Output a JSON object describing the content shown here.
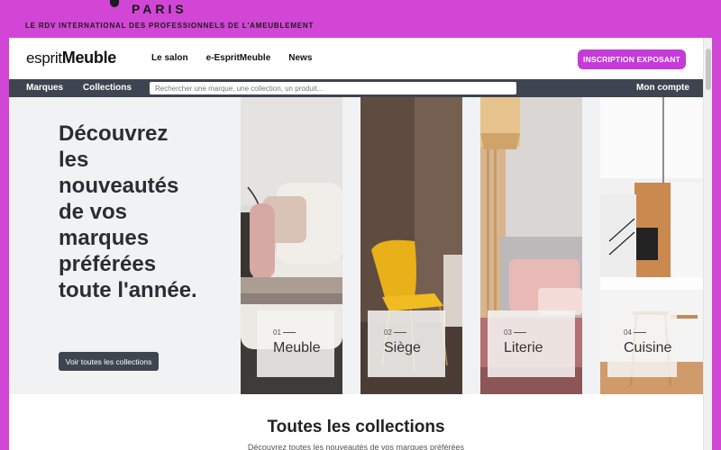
{
  "banner": {
    "city": "PARIS",
    "tagline": "LE RDV INTERNATIONAL DES PROFESSIONNELS DE L'AMEUBLEMENT"
  },
  "header": {
    "logo_prefix": "esprit",
    "logo_suffix": "Meuble",
    "nav": [
      "Le salon",
      "e-EspritMeuble",
      "News"
    ],
    "cta_label": "INSCRIPTION EXPOSANT"
  },
  "subbar": {
    "brands_label": "Marques",
    "collections_label": "Collections",
    "search_placeholder": "Rechercher une marque, une collection, un produit...",
    "account_label": "Mon compte"
  },
  "hero": {
    "title": "Découvrez les nouveautés de vos marques préférées toute l'année.",
    "button_label": "Voir toutes les collections",
    "tiles": [
      {
        "number": "01",
        "name": "Meuble"
      },
      {
        "number": "02",
        "name": "Siège"
      },
      {
        "number": "03",
        "name": "Literie"
      },
      {
        "number": "04",
        "name": "Cuisine"
      }
    ]
  },
  "section": {
    "title": "Toutes les collections",
    "subtitle": "Découvrez toutes les nouveautés de vos marques préférées"
  },
  "colors": {
    "frame": "#d146d4",
    "accent": "#c53ad9",
    "dark_bar": "#3e4550"
  }
}
